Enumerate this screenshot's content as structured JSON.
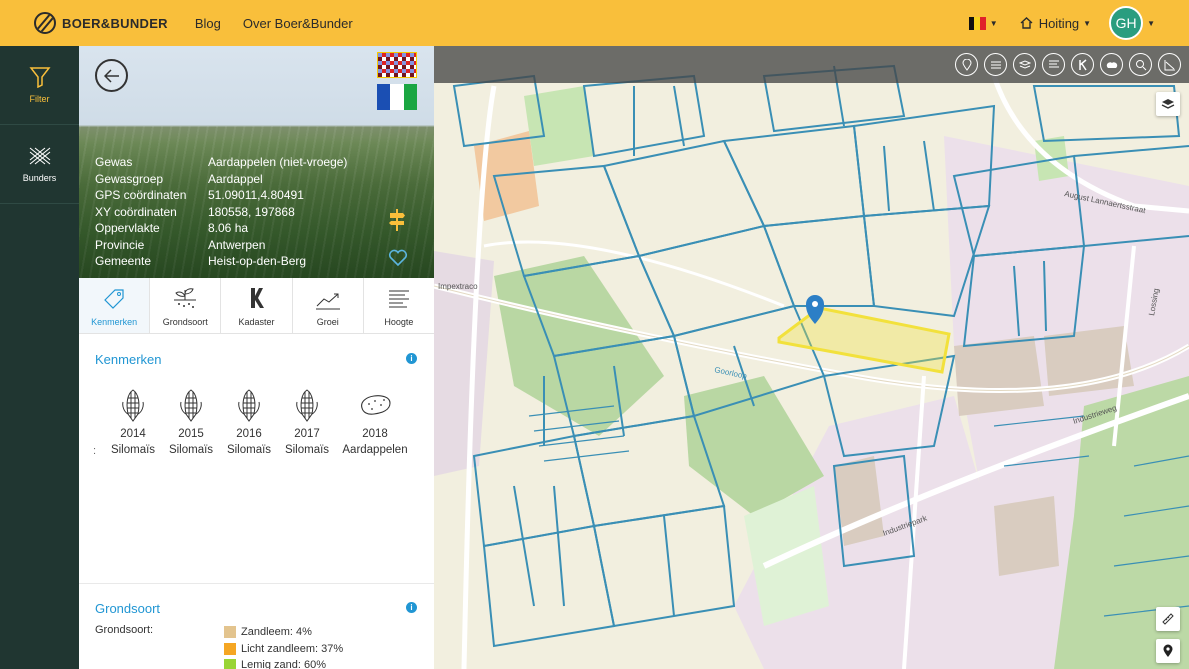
{
  "topbar": {
    "brand": "BOER&BUNDER",
    "nav": [
      {
        "label": "Blog"
      },
      {
        "label": "Over Boer&Bunder"
      }
    ],
    "language_flag": "belgium-flag-icon",
    "user_menu_label": "Hoiting",
    "avatar_initials": "GH",
    "background_color": "#f9bf3b",
    "avatar_color": "#2a9d7f"
  },
  "rail": {
    "items": [
      {
        "label": "Filter",
        "icon": "filter-icon",
        "active": true
      },
      {
        "label": "Bunders",
        "icon": "bunders-icon",
        "active": false
      }
    ],
    "background_color": "#203631"
  },
  "parcel": {
    "rows": [
      {
        "key": "Gewas",
        "value": "Aardappelen (niet-vroege)"
      },
      {
        "key": "Gewasgroep",
        "value": "Aardappel"
      },
      {
        "key": "GPS coördinaten",
        "value": "51.09011,4.80491"
      },
      {
        "key": "XY coördinaten",
        "value": "180558, 197868"
      },
      {
        "key": "Oppervlakte",
        "value": "8.06 ha"
      },
      {
        "key": "Provincie",
        "value": "Antwerpen"
      },
      {
        "key": "Gemeente",
        "value": "Heist-op-den-Berg"
      }
    ]
  },
  "tabs": [
    {
      "label": "Kenmerken",
      "icon": "tag-icon",
      "active": true
    },
    {
      "label": "Grondsoort",
      "icon": "soil-sprout-icon",
      "active": false
    },
    {
      "label": "Kadaster",
      "icon": "kadaster-k-icon",
      "active": false
    },
    {
      "label": "Groei",
      "icon": "growth-chart-icon",
      "active": false
    },
    {
      "label": "Hoogte",
      "icon": "height-lines-icon",
      "active": false
    }
  ],
  "kenmerken": {
    "title": "Kenmerken",
    "stub": ":",
    "crops": [
      {
        "year": "2014",
        "crop": "Silomaïs",
        "icon": "corn-icon"
      },
      {
        "year": "2015",
        "crop": "Silomaïs",
        "icon": "corn-icon"
      },
      {
        "year": "2016",
        "crop": "Silomaïs",
        "icon": "corn-icon"
      },
      {
        "year": "2017",
        "crop": "Silomaïs",
        "icon": "corn-icon"
      },
      {
        "year": "2018",
        "crop": "Aardappelen",
        "icon": "potato-icon"
      }
    ]
  },
  "grondsoort": {
    "title": "Grondsoort",
    "label": "Grondsoort:",
    "legend": [
      {
        "text": "Zandleem: 4%",
        "color": "#e3c48e"
      },
      {
        "text": "Licht zandleem: 37%",
        "color": "#f5a623"
      },
      {
        "text": "Lemig zand: 60%",
        "color": "#9ad435"
      }
    ]
  },
  "map": {
    "street_labels": [
      "Impextraco",
      "Industrieweg",
      "Industriepark",
      "Goorloop",
      "August Lannaertsstraat",
      "Lossing"
    ],
    "tools": [
      "marker-circle-icon",
      "water-icon",
      "layers-circle-icon",
      "list-circle-icon",
      "kadaster-circle-icon",
      "weather-icon",
      "search-zoom-icon",
      "slope-icon"
    ],
    "selected_parcel_color": "#f2e13c",
    "parcel_line_color": "#3a8fb5"
  }
}
